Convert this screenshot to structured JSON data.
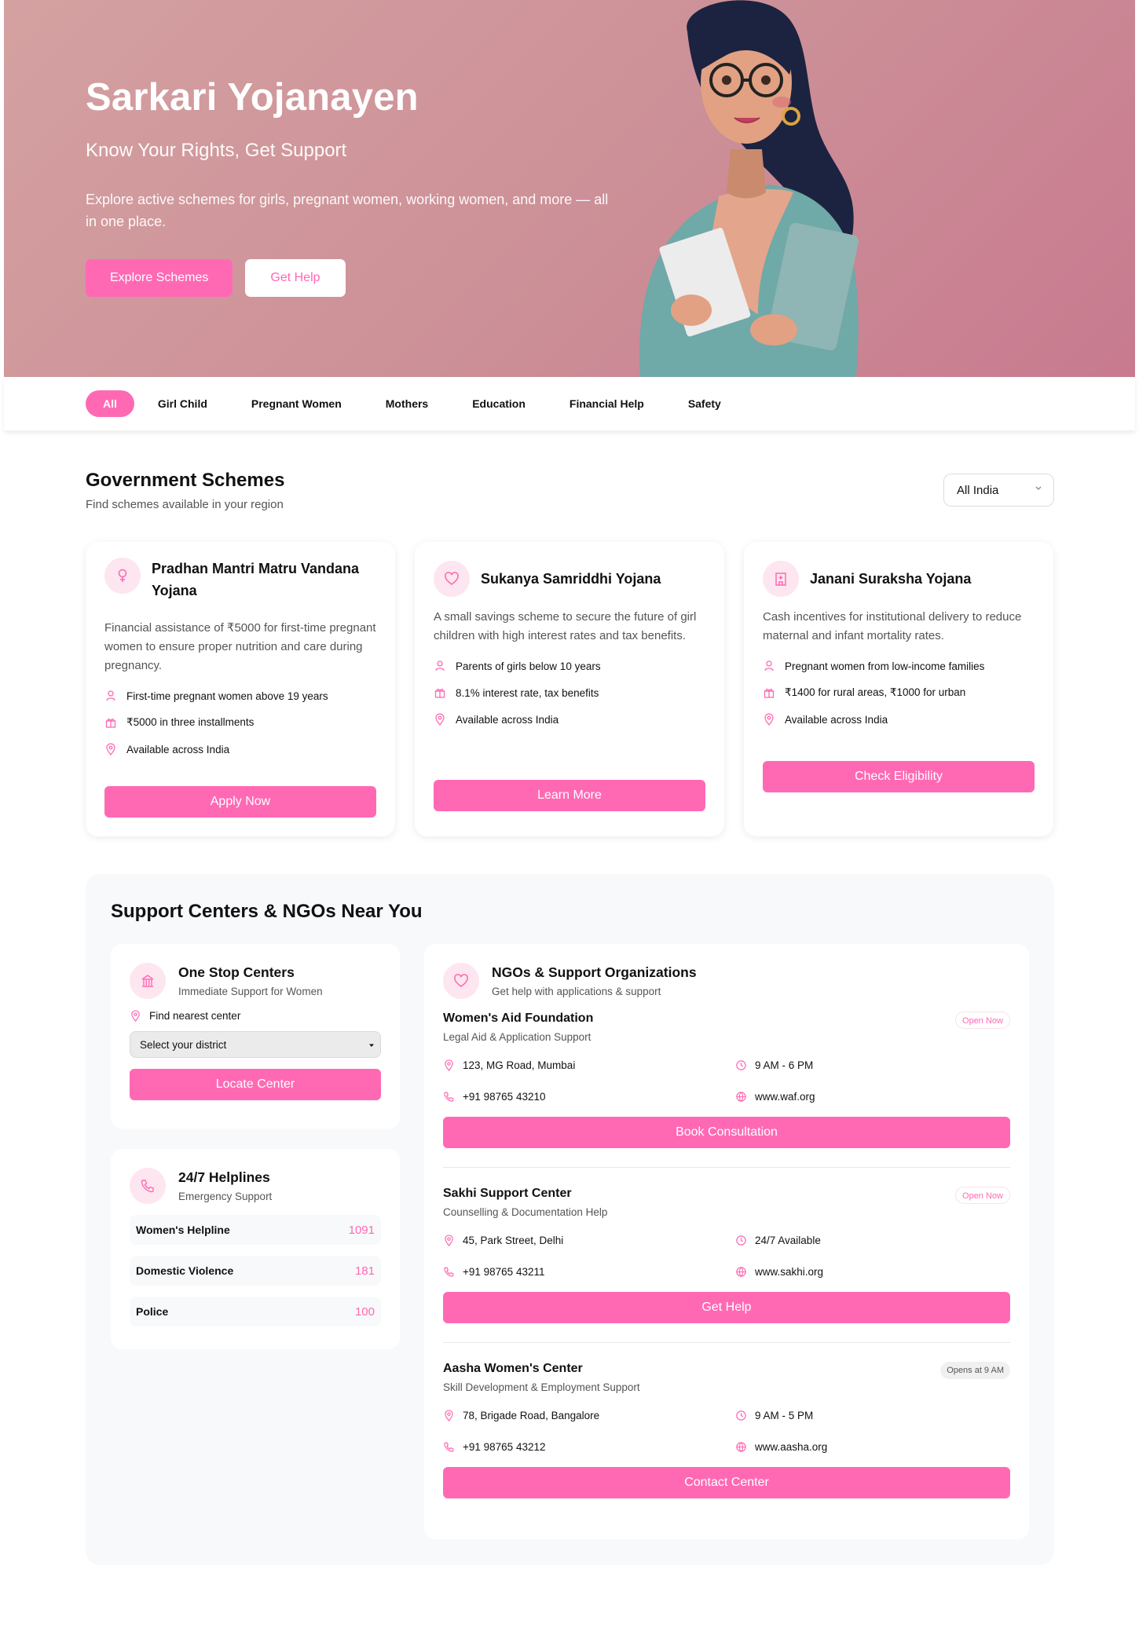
{
  "hero": {
    "title": "Sarkari Yojanayen",
    "subtitle": "Know Your Rights, Get Support",
    "description": "Explore active schemes for girls, pregnant women, working women, and more — all in one place.",
    "primary_button": "Explore Schemes",
    "secondary_button": "Get Help"
  },
  "filters": [
    "All",
    "Girl Child",
    "Pregnant Women",
    "Mothers",
    "Education",
    "Financial Help",
    "Safety"
  ],
  "schemes_section": {
    "title": "Government Schemes",
    "subtitle": "Find schemes available in your region",
    "region_selected": "All India"
  },
  "schemes": [
    {
      "icon": "female-icon",
      "title": "Pradhan Mantri Matru Vandana Yojana",
      "description": "Financial assistance of ₹5000 for first-time pregnant women to ensure proper nutrition and care during pregnancy.",
      "eligibility": "First-time pregnant women above 19 years",
      "benefit": "₹5000 in three installments",
      "availability": "Available across India",
      "button": "Apply Now"
    },
    {
      "icon": "heart-icon",
      "title": "Sukanya Samriddhi Yojana",
      "description": "A small savings scheme to secure the future of girl children with high interest rates and tax benefits.",
      "eligibility": "Parents of girls below 10 years",
      "benefit": "8.1% interest rate, tax benefits",
      "availability": "Available across India",
      "button": "Learn More"
    },
    {
      "icon": "hospital-icon",
      "title": "Janani Suraksha Yojana",
      "description": "Cash incentives for institutional delivery to reduce maternal and infant mortality rates.",
      "eligibility": "Pregnant women from low-income families",
      "benefit": "₹1400 for rural areas, ₹1000 for urban",
      "availability": "Available across India",
      "button": "Check Eligibility"
    }
  ],
  "support": {
    "title": "Support Centers & NGOs Near You",
    "one_stop": {
      "title": "One Stop Centers",
      "subtitle": "Immediate Support for Women",
      "find_label": "Find nearest center",
      "select_placeholder": "Select your district",
      "button": "Locate Center"
    },
    "helplines": {
      "title": "24/7 Helplines",
      "subtitle": "Emergency Support",
      "items": [
        {
          "label": "Women's Helpline",
          "number": "1091"
        },
        {
          "label": "Domestic Violence",
          "number": "181"
        },
        {
          "label": "Police",
          "number": "100"
        }
      ]
    },
    "ngos": {
      "title": "NGOs & Support Organizations",
      "subtitle": "Get help with applications & support",
      "items": [
        {
          "name": "Women's Aid Foundation",
          "type": "Legal Aid & Application Support",
          "status": "Open Now",
          "address": "123, MG Road, Mumbai",
          "hours": "9 AM - 6 PM",
          "phone": "+91 98765 43210",
          "website": "www.waf.org",
          "button": "Book Consultation"
        },
        {
          "name": "Sakhi Support Center",
          "type": "Counselling & Documentation Help",
          "status": "Open Now",
          "address": "45, Park Street, Delhi",
          "hours": "24/7 Available",
          "phone": "+91 98765 43211",
          "website": "www.sakhi.org",
          "button": "Get Help"
        },
        {
          "name": "Aasha Women's Center",
          "type": "Skill Development & Employment Support",
          "status": "Opens at 9 AM",
          "address": "78, Brigade Road, Bangalore",
          "hours": "9 AM - 5 PM",
          "phone": "+91 98765 43212",
          "website": "www.aasha.org",
          "button": "Contact Center"
        }
      ]
    }
  },
  "colors": {
    "accent": "#ff69b4",
    "hero_bg": "#cc8f97",
    "panel_bg": "#f8f9fb"
  }
}
